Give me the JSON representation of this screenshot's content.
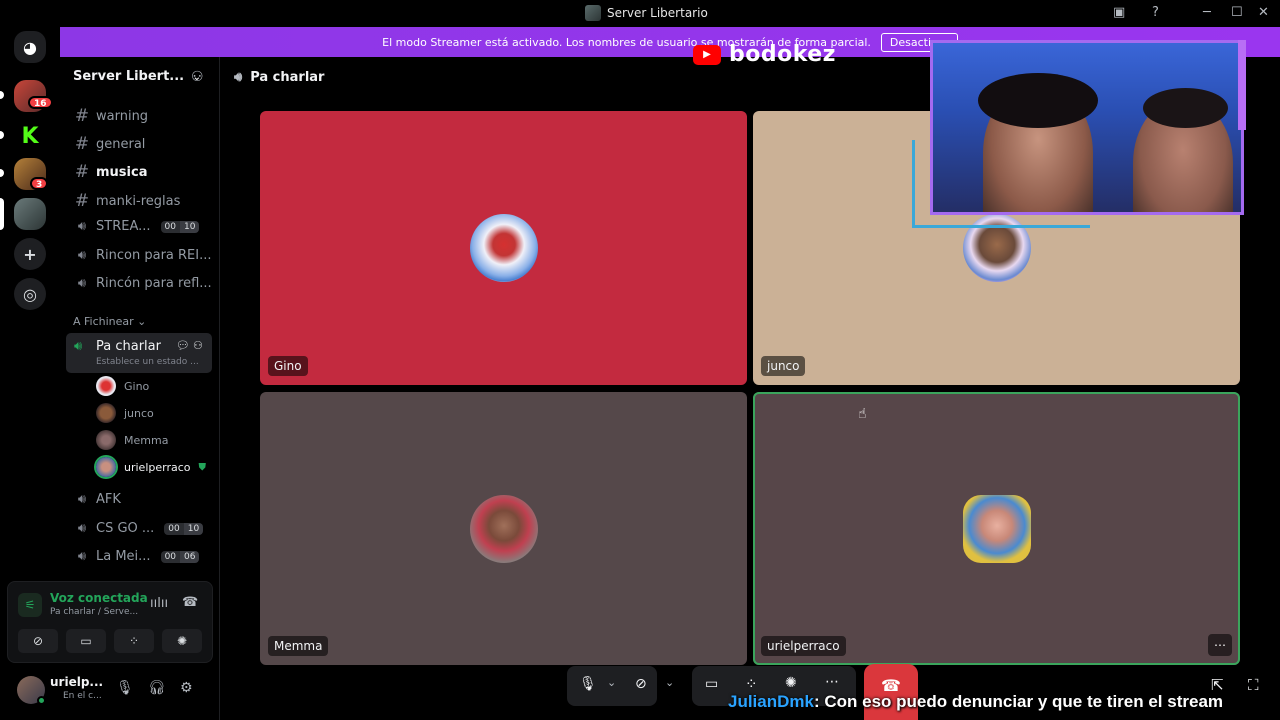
{
  "window": {
    "title": "Server Libertario"
  },
  "banner": {
    "text": "El modo Streamer está activado. Los nombres de usuario se mostrarán de forma parcial.",
    "button": "Desactivar"
  },
  "rail": {
    "badges": [
      "16",
      "3"
    ]
  },
  "server": {
    "name": "Server Libert..."
  },
  "channels": [
    {
      "type": "text",
      "name": "warning"
    },
    {
      "type": "text",
      "name": "general"
    },
    {
      "type": "text",
      "name": "musica",
      "active": true
    },
    {
      "type": "text",
      "name": "manki-reglas"
    },
    {
      "type": "voice",
      "name": "STREA...",
      "counts": [
        "00",
        "10"
      ]
    },
    {
      "type": "voice",
      "name": "Rincon para REI..."
    },
    {
      "type": "voice",
      "name": "Rincón para refl..."
    }
  ],
  "category": "A Fichinear",
  "current_channel": {
    "name": "Pa charlar",
    "status": "Establece un estado ..."
  },
  "voice_users": [
    "Gino",
    "junco",
    "Memma",
    "urielperraco"
  ],
  "more_channels": [
    {
      "name": "AFK"
    },
    {
      "name": "CS GO ...",
      "counts": [
        "00",
        "10"
      ]
    },
    {
      "name": "La Mei...",
      "counts": [
        "00",
        "06"
      ]
    }
  ],
  "voice_panel": {
    "status": "Voz conectada",
    "where": "Pa charlar / Serve..."
  },
  "user": {
    "name": "urielp...",
    "status": "En el c..."
  },
  "main": {
    "channel": "Pa charlar"
  },
  "tiles": [
    {
      "name": "Gino",
      "bg": "#c32a3f"
    },
    {
      "name": "junco",
      "bg": "#cbb196"
    },
    {
      "name": "Memma",
      "bg": "#55484a"
    },
    {
      "name": "urielperraco",
      "bg": "#574649"
    }
  ],
  "overlay": {
    "yt_channel": "bodokez",
    "chat_user": "JulianDmk",
    "chat_message": ": Con eso puedo denunciar y que te tiren el stream"
  },
  "colors": {
    "accent": "#8d37e6",
    "online": "#23a55a",
    "danger": "#da373c"
  }
}
